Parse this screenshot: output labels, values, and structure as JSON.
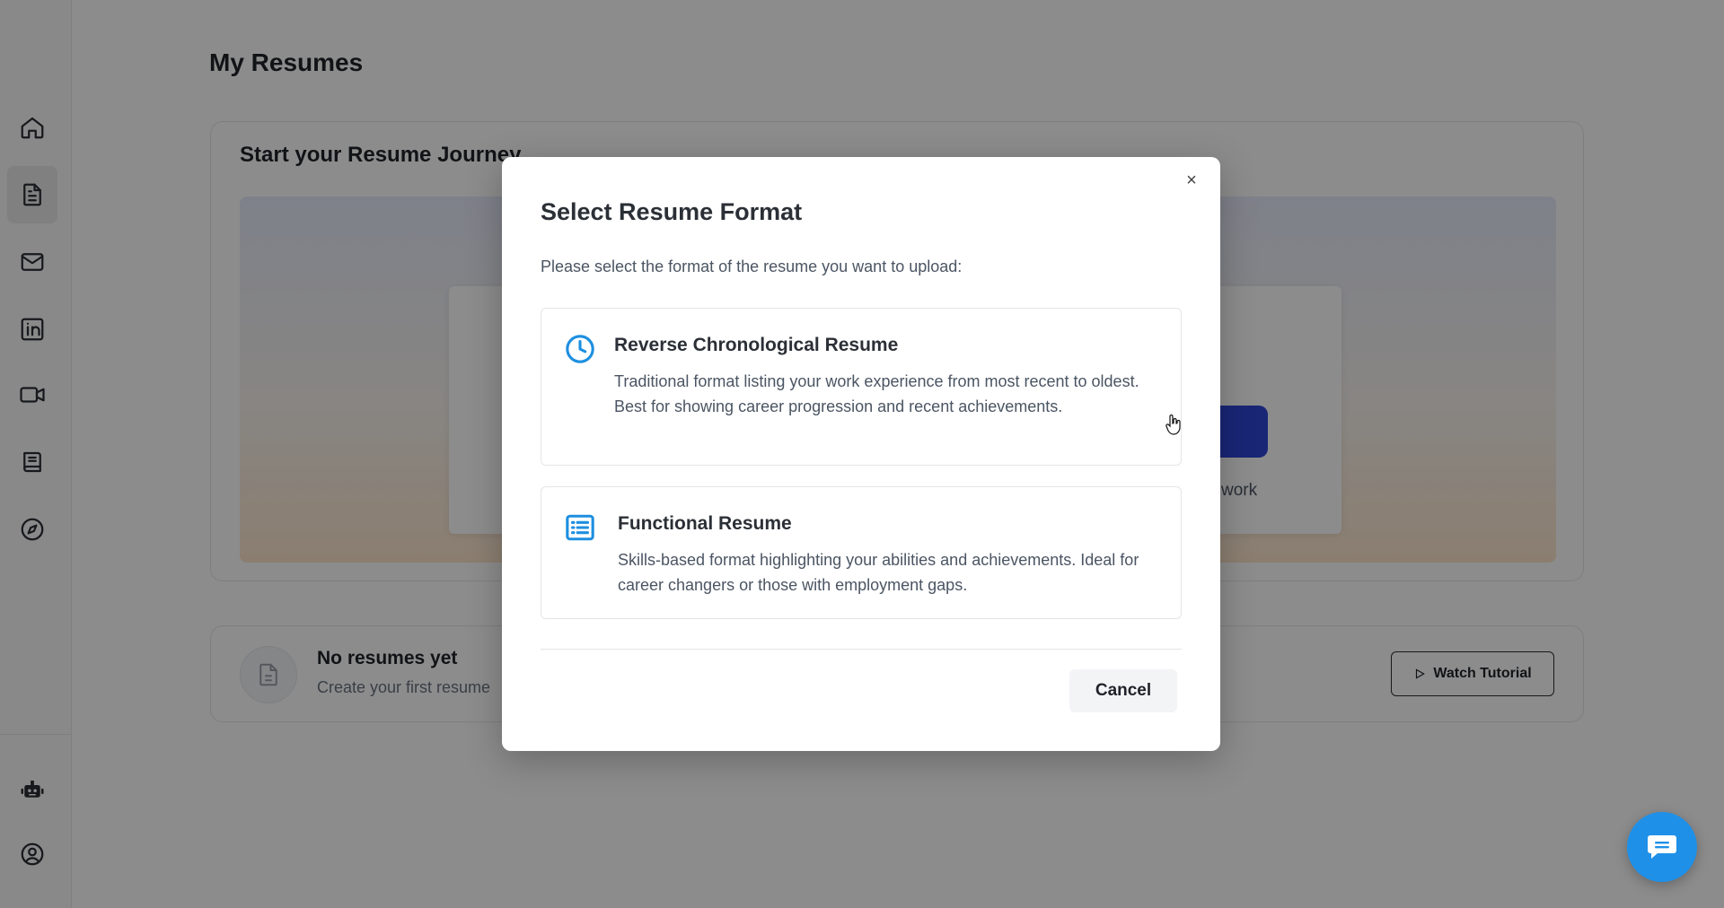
{
  "sidebar": {
    "items": [
      {
        "name": "home-icon"
      },
      {
        "name": "document-icon"
      },
      {
        "name": "mail-icon"
      },
      {
        "name": "linkedin-icon"
      },
      {
        "name": "video-icon"
      },
      {
        "name": "book-icon"
      },
      {
        "name": "compass-icon"
      }
    ],
    "bottom": [
      {
        "name": "robot-icon"
      },
      {
        "name": "user-circle-icon"
      }
    ]
  },
  "page": {
    "title": "My Resumes",
    "journey_title": "Start your Resume Journey",
    "journey_partial_text": "work",
    "empty_title": "No resumes yet",
    "empty_sub": "Create your first resume",
    "tutorial_label": "Watch Tutorial"
  },
  "modal": {
    "title": "Select Resume Format",
    "subtitle": "Please select the format of the resume you want to upload:",
    "close_label": "×",
    "options": [
      {
        "icon": "clock-icon",
        "title": "Reverse Chronological Resume",
        "description": "Traditional format listing your work experience from most recent to oldest. Best for showing career progression and recent achievements."
      },
      {
        "icon": "list-icon",
        "title": "Functional Resume",
        "description": "Skills-based format highlighting your abilities and achievements. Ideal for career changers or those with employment gaps."
      }
    ],
    "cancel_label": "Cancel"
  },
  "colors": {
    "accent": "#1d8fe0",
    "overlay": "rgba(0,0,0,0.45)",
    "chat": "#1e90e8"
  }
}
